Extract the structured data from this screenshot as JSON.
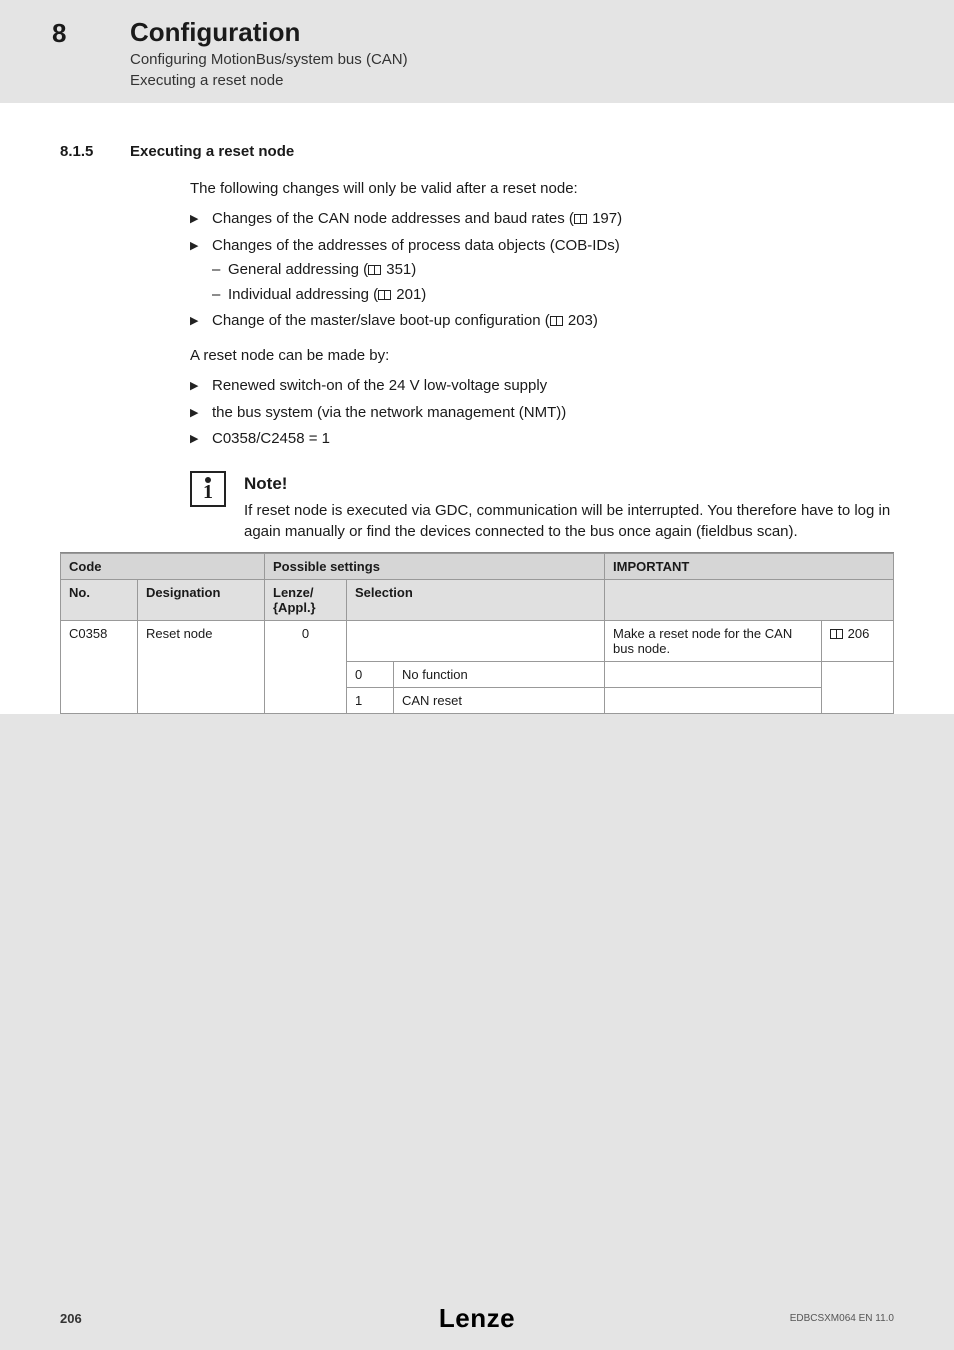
{
  "header": {
    "chapter_num": "8",
    "chapter_title": "Configuration",
    "sub1": "Configuring MotionBus/system bus (CAN)",
    "sub2": "Executing a reset node"
  },
  "section": {
    "num": "8.1.5",
    "title": "Executing a reset node"
  },
  "body": {
    "intro": "The following changes will only be valid after a reset node:",
    "b1_text": "Changes of the CAN node addresses and baud rates (",
    "b1_ref": " 197)",
    "b2_text": "Changes of the addresses of process data objects (COB-IDs)",
    "b2_d1_text": "General addressing (",
    "b2_d1_ref": " 351)",
    "b2_d2_text": "Individual addressing (",
    "b2_d2_ref": " 201)",
    "b3_text": "Change of the master/slave boot-up configuration (",
    "b3_ref": " 203)",
    "reset_intro": "A reset node can be made by:",
    "r1": "Renewed switch-on of the 24 V low-voltage supply",
    "r2": "the bus system (via the network management (NMT))",
    "r3": "C0358/C2458 = 1"
  },
  "note": {
    "title": "Note!",
    "text": "If reset node is executed via GDC, communication will be interrupted. You therefore have to log in again manually or find the devices connected to the bus once again (fieldbus scan)."
  },
  "table": {
    "th_code": "Code",
    "th_possible": "Possible settings",
    "th_important": "IMPORTANT",
    "th_no": "No.",
    "th_designation": "Designation",
    "th_lenze": "Lenze/\n{Appl.}",
    "th_selection": "Selection",
    "row_no": "C0358",
    "row_designation": "Reset node",
    "row_lenze": "0",
    "row_important": "Make a reset node for the CAN bus node.",
    "row_ref": " 206",
    "sel0_code": "0",
    "sel0_text": "No function",
    "sel1_code": "1",
    "sel1_text": "CAN reset"
  },
  "footer": {
    "page": "206",
    "logo": "Lenze",
    "docref": "EDBCSXM064 EN 11.0"
  }
}
